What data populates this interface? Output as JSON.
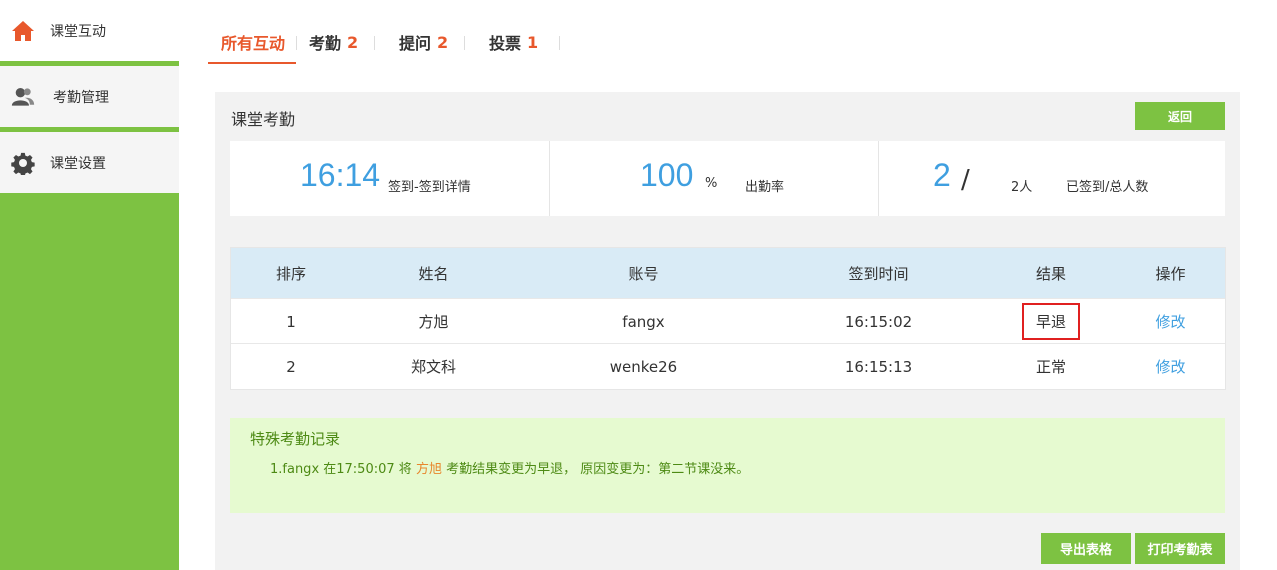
{
  "sidebar": {
    "items": [
      {
        "label": "课堂互动",
        "icon": "home-icon"
      },
      {
        "label": "考勤管理",
        "icon": "user-icon"
      },
      {
        "label": "课堂设置",
        "icon": "gear-icon"
      }
    ]
  },
  "tabs": [
    {
      "label": "所有互动",
      "count": ""
    },
    {
      "label": "考勤",
      "count": "2"
    },
    {
      "label": "提问",
      "count": "2"
    },
    {
      "label": "投票",
      "count": "1"
    }
  ],
  "panel": {
    "title": "课堂考勤",
    "back_label": "返回"
  },
  "stats": {
    "time": "16:14",
    "time_label": "签到-签到详情",
    "rate": "100",
    "rate_unit": "%",
    "rate_label": "出勤率",
    "signed": "2",
    "slash": "/",
    "total": "2人",
    "count_label": "已签到/总人数"
  },
  "table": {
    "headers": [
      "排序",
      "姓名",
      "账号",
      "签到时间",
      "结果",
      "操作"
    ],
    "rows": [
      {
        "no": "1",
        "name": "方旭",
        "account": "fangx",
        "time": "16:15:02",
        "result": "早退",
        "action": "修改"
      },
      {
        "no": "2",
        "name": "郑文科",
        "account": "wenke26",
        "time": "16:15:13",
        "result": "正常",
        "action": "修改"
      }
    ]
  },
  "special": {
    "title": "特殊考勤记录",
    "record_prefix": "1.fangx 在17:50:07 将",
    "record_name": "方旭",
    "record_suffix": "考勤结果变更为早退， 原因变更为：第二节课没来。"
  },
  "buttons": {
    "export": "导出表格",
    "print": "打印考勤表"
  },
  "colors": {
    "green": "#7dc242",
    "accent_orange": "#e8582c",
    "blue": "#3f9fe0",
    "alert_red": "#e02020"
  }
}
